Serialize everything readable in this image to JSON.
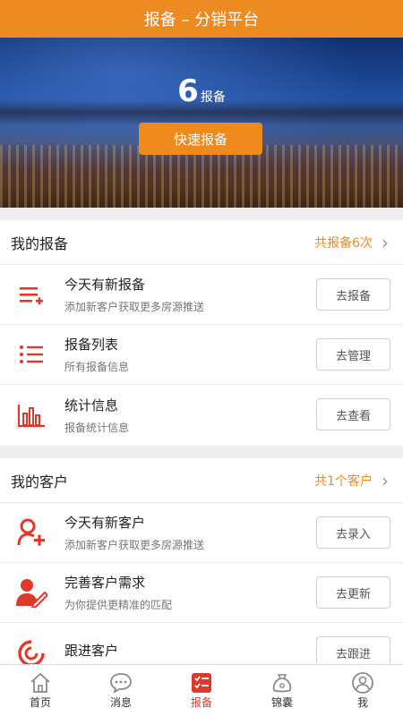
{
  "title": "报备 – 分销平台",
  "hero": {
    "count": "6",
    "count_unit": "报备",
    "quick_button": "快速报备"
  },
  "reports": {
    "title": "我的报备",
    "summary": "共报备6次",
    "items": [
      {
        "title": "今天有新报备",
        "subtitle": "添加新客户获取更多房源推送",
        "button": "去报备",
        "icon": "add-list-icon"
      },
      {
        "title": "报备列表",
        "subtitle": "所有报备信息",
        "button": "去管理",
        "icon": "list-icon"
      },
      {
        "title": "统计信息",
        "subtitle": "报备统计信息",
        "button": "去查看",
        "icon": "bar-chart-icon"
      }
    ]
  },
  "customers": {
    "title": "我的客户",
    "summary": "共1个客户",
    "items": [
      {
        "title": "今天有新客户",
        "subtitle": "添加新客户获取更多房源推送",
        "button": "去录入",
        "icon": "add-user-icon"
      },
      {
        "title": "完善客户需求",
        "subtitle": "为你提供更精准的匹配",
        "button": "去更新",
        "icon": "edit-user-icon"
      },
      {
        "title": "跟进客户",
        "subtitle": "",
        "button": "去跟进",
        "icon": "follow-up-icon"
      }
    ]
  },
  "tabbar": {
    "items": [
      {
        "label": "首页",
        "icon": "home-icon"
      },
      {
        "label": "消息",
        "icon": "message-icon"
      },
      {
        "label": "报备",
        "icon": "report-icon"
      },
      {
        "label": "锦囊",
        "icon": "pouch-icon"
      },
      {
        "label": "我",
        "icon": "user-icon"
      }
    ],
    "active": "报备"
  },
  "colors": {
    "accent": "#ee8a22",
    "active": "#e0392b"
  }
}
